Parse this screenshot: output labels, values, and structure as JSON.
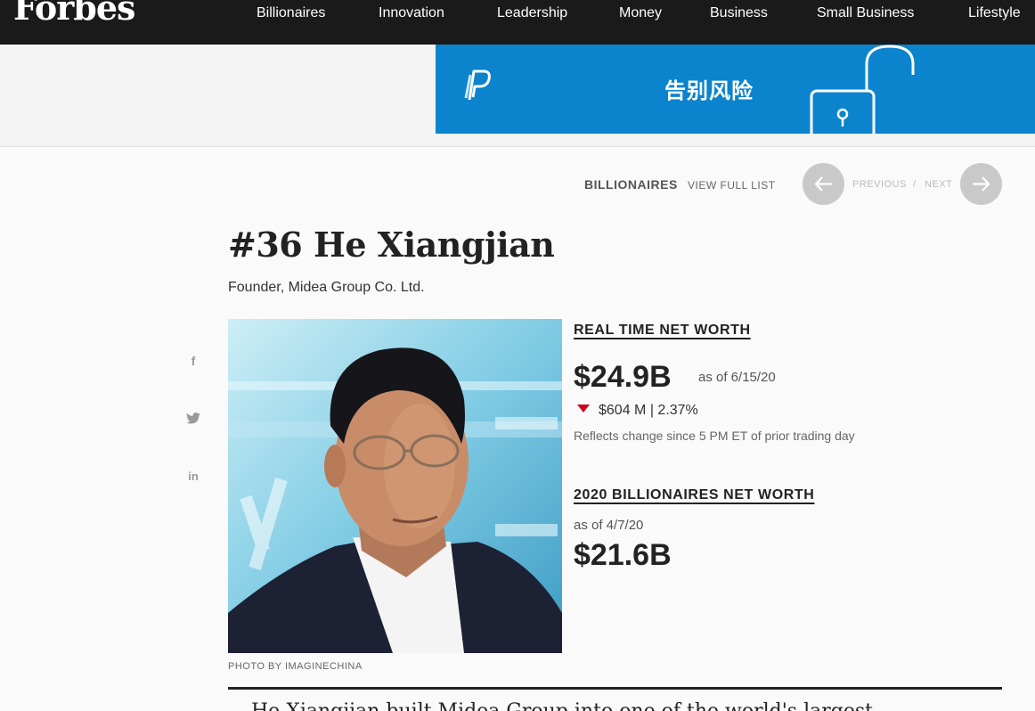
{
  "brand": "Forbes",
  "nav": [
    "Billionaires",
    "Innovation",
    "Leadership",
    "Money",
    "Business",
    "Small Business",
    "Lifestyle"
  ],
  "ad": {
    "text": "告别风险",
    "color": "#0b84cd"
  },
  "breadcrumb": {
    "section": "BILLIONAIRES",
    "view_full": "VIEW FULL LIST"
  },
  "pager": {
    "previous": "PREVIOUS",
    "separator": "/",
    "next": "NEXT"
  },
  "profile": {
    "title": "#36 He Xiangjian",
    "subtitle": "Founder, Midea Group Co. Ltd.",
    "photo_credit": "PHOTO BY IMAGINECHINA"
  },
  "realtime": {
    "heading": "REAL TIME NET WORTH",
    "value": "$24.9B",
    "as_of": "as of 6/15/20",
    "change": "$604 M | 2.37%",
    "change_direction": "down",
    "note": "Reflects change since 5 PM ET of prior trading day"
  },
  "list2020": {
    "heading": "2020 BILLIONAIRES NET WORTH",
    "as_of": "as of 4/7/20",
    "value": "$21.6B"
  },
  "bio_start": "He Xiangjian built Midea Group into one of the world's largest"
}
